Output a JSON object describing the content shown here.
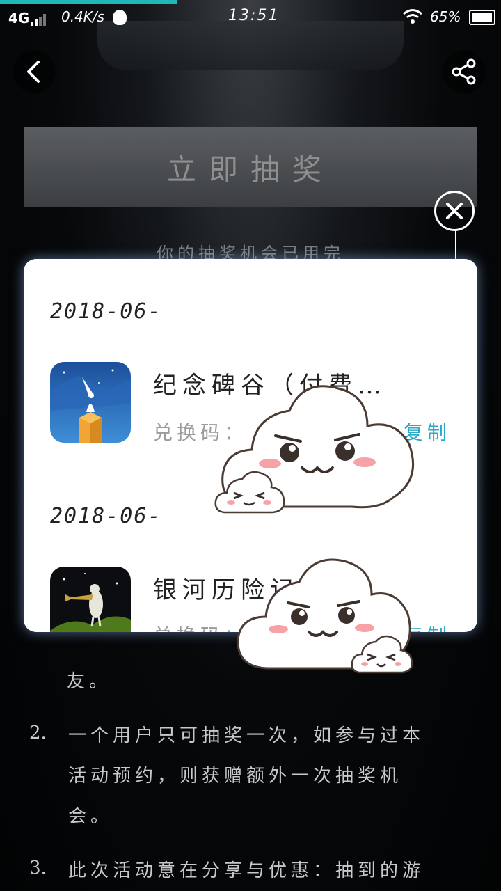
{
  "status_bar": {
    "network": "4G",
    "speed": "0.4K/s",
    "time": "13:51",
    "battery": "65%"
  },
  "banner": {
    "label": "立即抽奖"
  },
  "chance_text": "你的抽奖机会已用完",
  "modal": {
    "items": [
      {
        "date": "2018-06-",
        "title": "纪念碑谷（付费…",
        "code_label": "兑换码：",
        "copy_label": "复制"
      },
      {
        "date": "2018-06-",
        "title": "银河历险记",
        "code_label": "兑换码：",
        "copy_label": "复制"
      }
    ]
  },
  "rules": {
    "line0": "友。",
    "item2_num": "2.",
    "item2_line1": "一个用户只可抽奖一次，如参与过本",
    "item2_line2": "活动预约，则获赠额外一次抽奖机",
    "item2_line3": "会。",
    "item3_num": "3.",
    "item3_line1": "此次活动意在分享与优惠：抽到的游"
  },
  "icons": {
    "back": "back-arrow-icon",
    "share": "share-icon",
    "close": "close-icon"
  },
  "colors": {
    "accent": "#2aa7c9",
    "progress": "#1fb7b7"
  }
}
